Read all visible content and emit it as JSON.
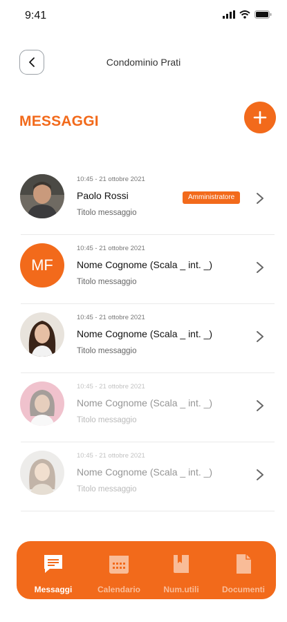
{
  "status_bar": {
    "time": "9:41"
  },
  "header": {
    "title": "Condominio Prati",
    "back_icon": "chevron-left-icon"
  },
  "section": {
    "title": "MESSAGGI",
    "add_icon": "plus-icon"
  },
  "messages": [
    {
      "timestamp": "10:45 - 21 ottobre 2021",
      "name": "Paolo Rossi",
      "badge": "Amministratore",
      "subtitle": "Titolo messaggio",
      "avatar": "photo"
    },
    {
      "timestamp": "10:45 - 21 ottobre 2021",
      "name": "Nome Cognome  (Scala _ int. _)",
      "subtitle": "Titolo messaggio",
      "avatar_initials": "MF"
    },
    {
      "timestamp": "10:45 - 21 ottobre 2021",
      "name": "Nome Cognome  (Scala _ int. _)",
      "subtitle": "Titolo messaggio",
      "avatar": "photo"
    },
    {
      "timestamp": "10:45 - 21 ottobre 2021",
      "name": "Nome Cognome  (Scala _ int. _)",
      "subtitle": "Titolo messaggio",
      "avatar": "photo"
    },
    {
      "timestamp": "10:45 - 21 ottobre 2021",
      "name": "Nome Cognome  (Scala _ int. _)",
      "subtitle": "Titolo messaggio",
      "avatar": "photo"
    }
  ],
  "tabbar": {
    "items": [
      {
        "label": "Messaggi",
        "icon": "chat-icon",
        "active": true
      },
      {
        "label": "Calendario",
        "icon": "calendar-icon",
        "active": false
      },
      {
        "label": "Num.utili",
        "icon": "book-icon",
        "active": false
      },
      {
        "label": "Documenti",
        "icon": "document-icon",
        "active": false
      }
    ]
  },
  "colors": {
    "accent": "#f26a1b",
    "text": "#111111"
  }
}
